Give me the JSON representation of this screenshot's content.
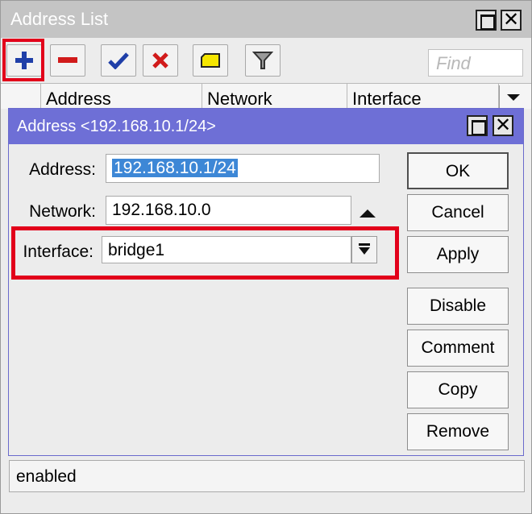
{
  "list_window": {
    "title": "Address List",
    "toolbar": {
      "find_placeholder": "Find"
    },
    "columns": [
      "Address",
      "Network",
      "Interface"
    ],
    "status": "enabled"
  },
  "dialog": {
    "title": "Address <192.168.10.1/24>",
    "fields": {
      "address_label": "Address:",
      "address_value": "192.168.10.1/24",
      "network_label": "Network:",
      "network_value": "192.168.10.0",
      "interface_label": "Interface:",
      "interface_value": "bridge1"
    },
    "buttons": {
      "ok": "OK",
      "cancel": "Cancel",
      "apply": "Apply",
      "disable": "Disable",
      "comment": "Comment",
      "copy": "Copy",
      "remove": "Remove"
    }
  },
  "colors": {
    "highlight": "#e2001a",
    "dialog_title": "#6e6fd6",
    "selection": "#3d87d6"
  },
  "icons": [
    "add-icon",
    "remove-icon",
    "enable-check-icon",
    "disable-x-icon",
    "comment-note-icon",
    "filter-icon",
    "sort-arrow-icon",
    "maximize-icon",
    "close-icon",
    "scroll-up-icon",
    "dropdown-icon"
  ]
}
